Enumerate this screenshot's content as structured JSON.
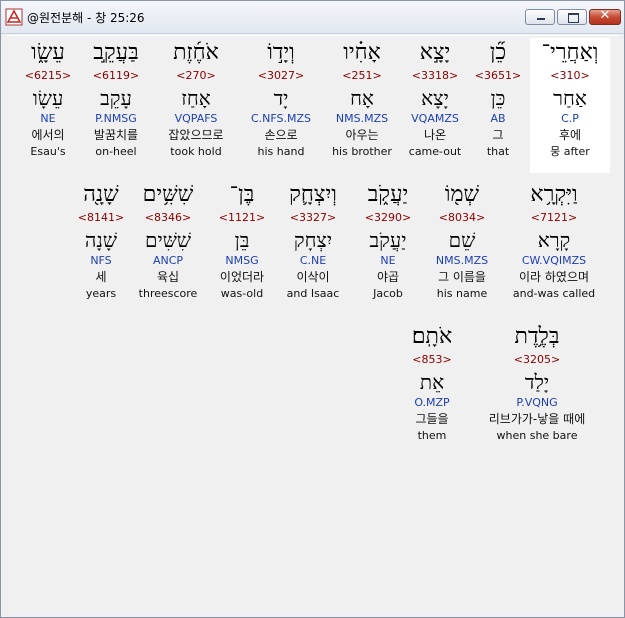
{
  "window": {
    "title": "@원전분해 - 창 25:26",
    "minimize_label": "",
    "maximize_label": "",
    "close_label": "✕"
  },
  "words": [
    {
      "hebrew": "עֵשָׂ֑ו",
      "strong": "<6215>",
      "lemma": "עֵשָׂו",
      "morph": "NE",
      "korean": "에서의",
      "english": "Esau's"
    },
    {
      "hebrew": "בַּעֲקֵ֣ב",
      "strong": "<6119>",
      "lemma": "עָקֵב",
      "morph": "P.NMSG",
      "korean": "발꿈치를",
      "english": "on-heel"
    },
    {
      "hebrew": "אֹחֶ֜זֶת",
      "strong": "<270>",
      "lemma": "אָחַז",
      "morph": "VQPAFS",
      "korean": "잡았으므로",
      "english": "took hold"
    },
    {
      "hebrew": "וְיָד֣וֹ",
      "strong": "<3027>",
      "lemma": "יָד",
      "morph": "C.NFS.MZS",
      "korean": "손으로",
      "english": "his hand"
    },
    {
      "hebrew": "אָחִ֗יו",
      "strong": "<251>",
      "lemma": "אָח",
      "morph": "NMS.MZS",
      "korean": "아우는",
      "english": "his brother"
    },
    {
      "hebrew": "יָצָ֣א",
      "strong": "<3318>",
      "lemma": "יָצָא",
      "morph": "VQAMZS",
      "korean": "나온",
      "english": "came-out"
    },
    {
      "hebrew": "כֵ֞ן",
      "strong": "<3651>",
      "lemma": "כֵּן",
      "morph": "AB",
      "korean": "그",
      "english": "that"
    },
    {
      "hebrew": "וְאַחֲרֵי־",
      "strong": "<310>",
      "lemma": "אַחַר",
      "morph": "C.P",
      "korean": "후에",
      "english": "뭉 after"
    },
    {
      "hebrew": "שָׁנָ֖ה",
      "strong": "<8141>",
      "lemma": "שָׁנָה",
      "morph": "NFS",
      "korean": "세",
      "english": "years"
    },
    {
      "hebrew": "שִׁשִּׁ֥ים",
      "strong": "<8346>",
      "lemma": "שִׁשִּׁים",
      "morph": "ANCP",
      "korean": "육십",
      "english": "threescore"
    },
    {
      "hebrew": "בֶּן־",
      "strong": "<1121>",
      "lemma": "בֵּן",
      "morph": "NMSG",
      "korean": "이었더라",
      "english": "was-old"
    },
    {
      "hebrew": "וְיִצְחָ֛ק",
      "strong": "<3327>",
      "lemma": "יִצְחָק",
      "morph": "C.NE",
      "korean": "이삭이",
      "english": "and Isaac"
    },
    {
      "hebrew": "יַעֲקֹ֑ב",
      "strong": "<3290>",
      "lemma": "יַעֲקֹב",
      "morph": "NE",
      "korean": "야곱",
      "english": "Jacob"
    },
    {
      "hebrew": "שְׁמ֖וֹ",
      "strong": "<8034>",
      "lemma": "שֵׁם",
      "morph": "NMS.MZS",
      "korean": "그 이름을",
      "english": "his name"
    },
    {
      "hebrew": "וַיִּקְרָ֥א",
      "strong": "<7121>",
      "lemma": "קָרָא",
      "morph": "CW.VQIMZS",
      "korean": "이라 하였으며",
      "english": "and-was called"
    },
    {
      "hebrew": "אֹתָֽם׃",
      "strong": "<853>",
      "lemma": "אֵת",
      "morph": "O.MZP",
      "korean": "그들을",
      "english": "them"
    },
    {
      "hebrew": "בְּלֶ֥דֶת",
      "strong": "<3205>",
      "lemma": "יָלַד",
      "morph": "P.VQNG",
      "korean": "리브가가-낳을 때에",
      "english": "when she bare"
    }
  ]
}
